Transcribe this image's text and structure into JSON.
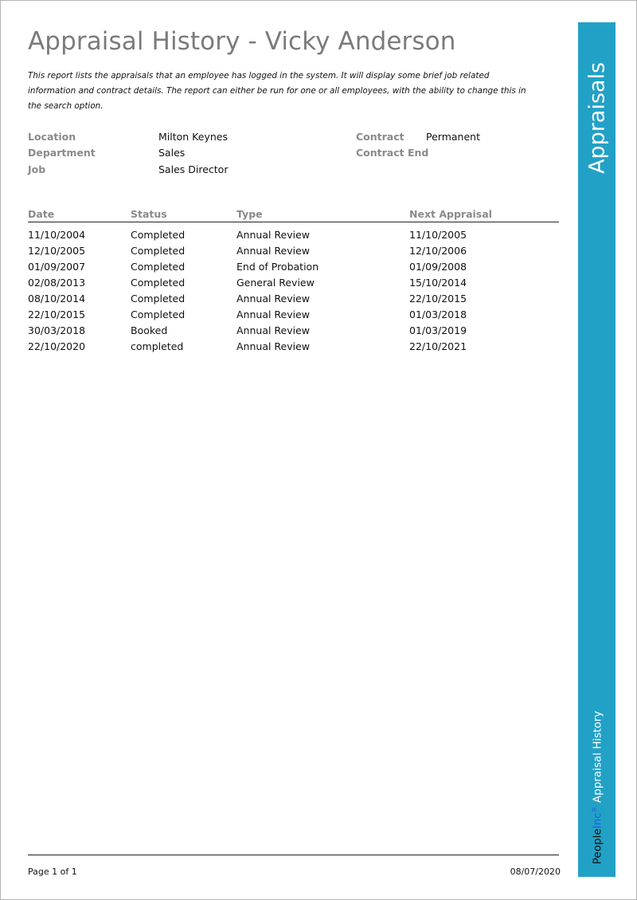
{
  "report": {
    "title": "Appraisal History - Vicky Anderson",
    "description_lines": [
      "This report lists the appraisals that an employee has logged in the system. It will display some brief job related",
      "information and contract details. The report can either be run for one or all employees, with the ability to change this in",
      "the search option."
    ]
  },
  "employee_info": {
    "location_label": "Location",
    "location_value": "Milton Keynes",
    "department_label": "Department",
    "department_value": "Sales",
    "job_label": "Job",
    "job_value": "Sales Director",
    "contract_label": "Contract",
    "contract_value": "Permanent",
    "contract_end_label": "Contract End",
    "contract_end_value": ""
  },
  "table": {
    "headers": {
      "date": "Date",
      "status": "Status",
      "type": "Type",
      "next_appraisal": "Next Appraisal"
    },
    "rows": [
      {
        "date": "11/10/2004",
        "status": "Completed",
        "type": "Annual Review",
        "next": "11/10/2005"
      },
      {
        "date": "12/10/2005",
        "status": "Completed",
        "type": "Annual Review",
        "next": "12/10/2006"
      },
      {
        "date": "01/09/2007",
        "status": "Completed",
        "type": "End of Probation",
        "next": "01/09/2008"
      },
      {
        "date": "02/08/2013",
        "status": "Completed",
        "type": "General Review",
        "next": "15/10/2014"
      },
      {
        "date": "08/10/2014",
        "status": "Completed",
        "type": "Annual Review",
        "next": "22/10/2015"
      },
      {
        "date": "22/10/2015",
        "status": "Completed",
        "type": "Annual Review",
        "next": "01/03/2018"
      },
      {
        "date": "30/03/2018",
        "status": "Booked",
        "type": "Annual Review",
        "next": "01/03/2019"
      },
      {
        "date": "22/10/2020",
        "status": "completed",
        "type": "Annual Review",
        "next": "22/10/2021"
      }
    ]
  },
  "footer": {
    "page": "Page 1 of 1",
    "date": "08/07/2020"
  },
  "sidebar": {
    "title": "Appraisals",
    "brand_people": "People",
    "brand_inc": "Inc",
    "brand_reg": "®",
    "brand_rest": " Appraisal History"
  },
  "colors": {
    "sidebar": "#22a1c6",
    "title": "#7b7b7b",
    "label": "#8a8a8a",
    "brand_inc": "#1e5ee6"
  }
}
